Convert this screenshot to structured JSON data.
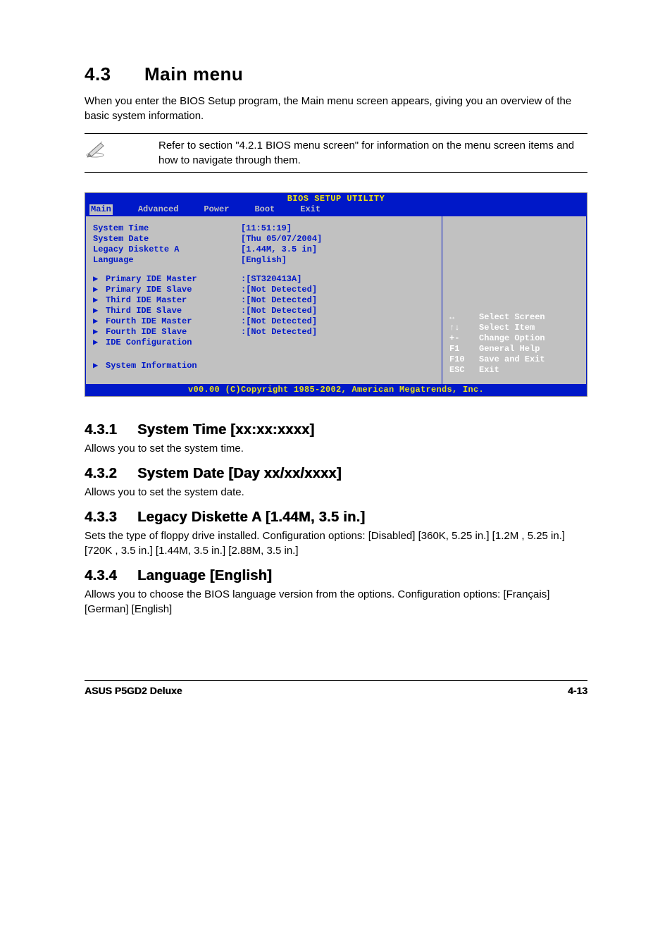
{
  "section": {
    "number": "4.3",
    "title": "Main menu"
  },
  "intro": "When you enter the BIOS Setup program, the Main menu screen appears, giving you an overview of the basic system information.",
  "note": "Refer to section \"4.2.1  BIOS menu screen\" for information on the menu screen items and how to navigate through them.",
  "bios": {
    "title": "BIOS SETUP UTILITY",
    "tabs": [
      "Main",
      "Advanced",
      "Power",
      "Boot",
      "Exit"
    ],
    "active_tab": "Main",
    "rows": [
      {
        "label": "System Time",
        "value": "[11:51:19]"
      },
      {
        "label": "System Date",
        "value": "[Thu 05/07/2004]"
      },
      {
        "label": "Legacy Diskette A",
        "value": "[1.44M, 3.5 in]"
      },
      {
        "label": "Language",
        "value": "[English]"
      }
    ],
    "subs": [
      {
        "label": "Primary IDE Master",
        "value": ":[ST320413A]"
      },
      {
        "label": "Primary IDE Slave",
        "value": ":[Not Detected]"
      },
      {
        "label": "Third IDE Master",
        "value": ":[Not Detected]"
      },
      {
        "label": "Third IDE Slave",
        "value": ":[Not Detected]"
      },
      {
        "label": "Fourth IDE Master",
        "value": ":[Not Detected]"
      },
      {
        "label": "Fourth IDE Slave",
        "value": ":[Not Detected]"
      },
      {
        "label": "IDE Configuration",
        "value": ""
      }
    ],
    "sysinfo": "System Information",
    "help": [
      {
        "key": "↔",
        "text": "Select Screen"
      },
      {
        "key": "↑↓",
        "text": "Select Item"
      },
      {
        "key": "+-",
        "text": "Change Option"
      },
      {
        "key": "F1",
        "text": "General Help"
      },
      {
        "key": "F10",
        "text": "Save and Exit"
      },
      {
        "key": "ESC",
        "text": "Exit"
      }
    ],
    "footer": "v00.00 (C)Copyright 1985-2002, American Megatrends, Inc."
  },
  "subsections": [
    {
      "num": "4.3.1",
      "title": "System Time [xx:xx:xxxx]",
      "body": "Allows you to set the system time."
    },
    {
      "num": "4.3.2",
      "title": "System Date [Day xx/xx/xxxx]",
      "body": "Allows you to set the system date."
    },
    {
      "num": "4.3.3",
      "title": "Legacy Diskette A [1.44M, 3.5 in.]",
      "body": "Sets the type of floppy drive installed. Configuration options: [Disabled] [360K, 5.25 in.] [1.2M , 5.25 in.] [720K , 3.5 in.] [1.44M, 3.5 in.] [2.88M, 3.5 in.]"
    },
    {
      "num": "4.3.4",
      "title": "Language [English]",
      "body": "Allows you to choose the BIOS language version from the options. Configuration options: [Français] [German] [English]"
    }
  ],
  "footer": {
    "left": "ASUS P5GD2 Deluxe",
    "right": "4-13"
  }
}
